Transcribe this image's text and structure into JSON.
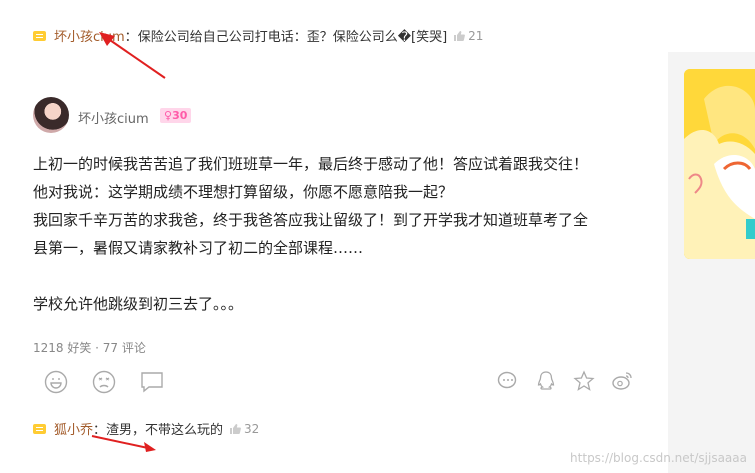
{
  "top_comment": {
    "user": "坏小孩cium",
    "separator": "：",
    "text": "保险公司给自己公司打电话：歪？保险公司么�[笑哭]",
    "likes": "21"
  },
  "author": {
    "name": "坏小孩cium",
    "level": "30"
  },
  "post": {
    "lines": [
      "上初一的时候我苦苦追了我们班班草一年，最后终于感动了他！答应试着跟我交往！",
      "他对我说：这学期成绩不理想打算留级，你愿不愿意陪我一起？",
      "我回家千辛万苦的求我爸，终于我爸答应我让留级了！到了开学我才知道班草考了全",
      "县第一，暑假又请家教补习了初二的全部课程……",
      "学校允许他跳级到初三去了。。。"
    ]
  },
  "stats": {
    "text": "1218 好笑 · 77 评论"
  },
  "bottom_comment": {
    "user": "狐小乔",
    "separator": "：",
    "text": "渣男，不带这么玩的",
    "likes": "32"
  },
  "watermark": "https://blog.csdn.net/sjjsaaaa",
  "colors": {
    "accent_red": "#e02020",
    "username_brown": "#a35c2b",
    "badge_pink": "#ff5aa8",
    "banner_yellow": "#ffd83a"
  },
  "icons": [
    "comment-icon",
    "thumb-up-icon",
    "smile-icon",
    "angry-icon",
    "chat-icon",
    "wechat-icon",
    "qq-icon",
    "star-icon",
    "weibo-icon"
  ]
}
